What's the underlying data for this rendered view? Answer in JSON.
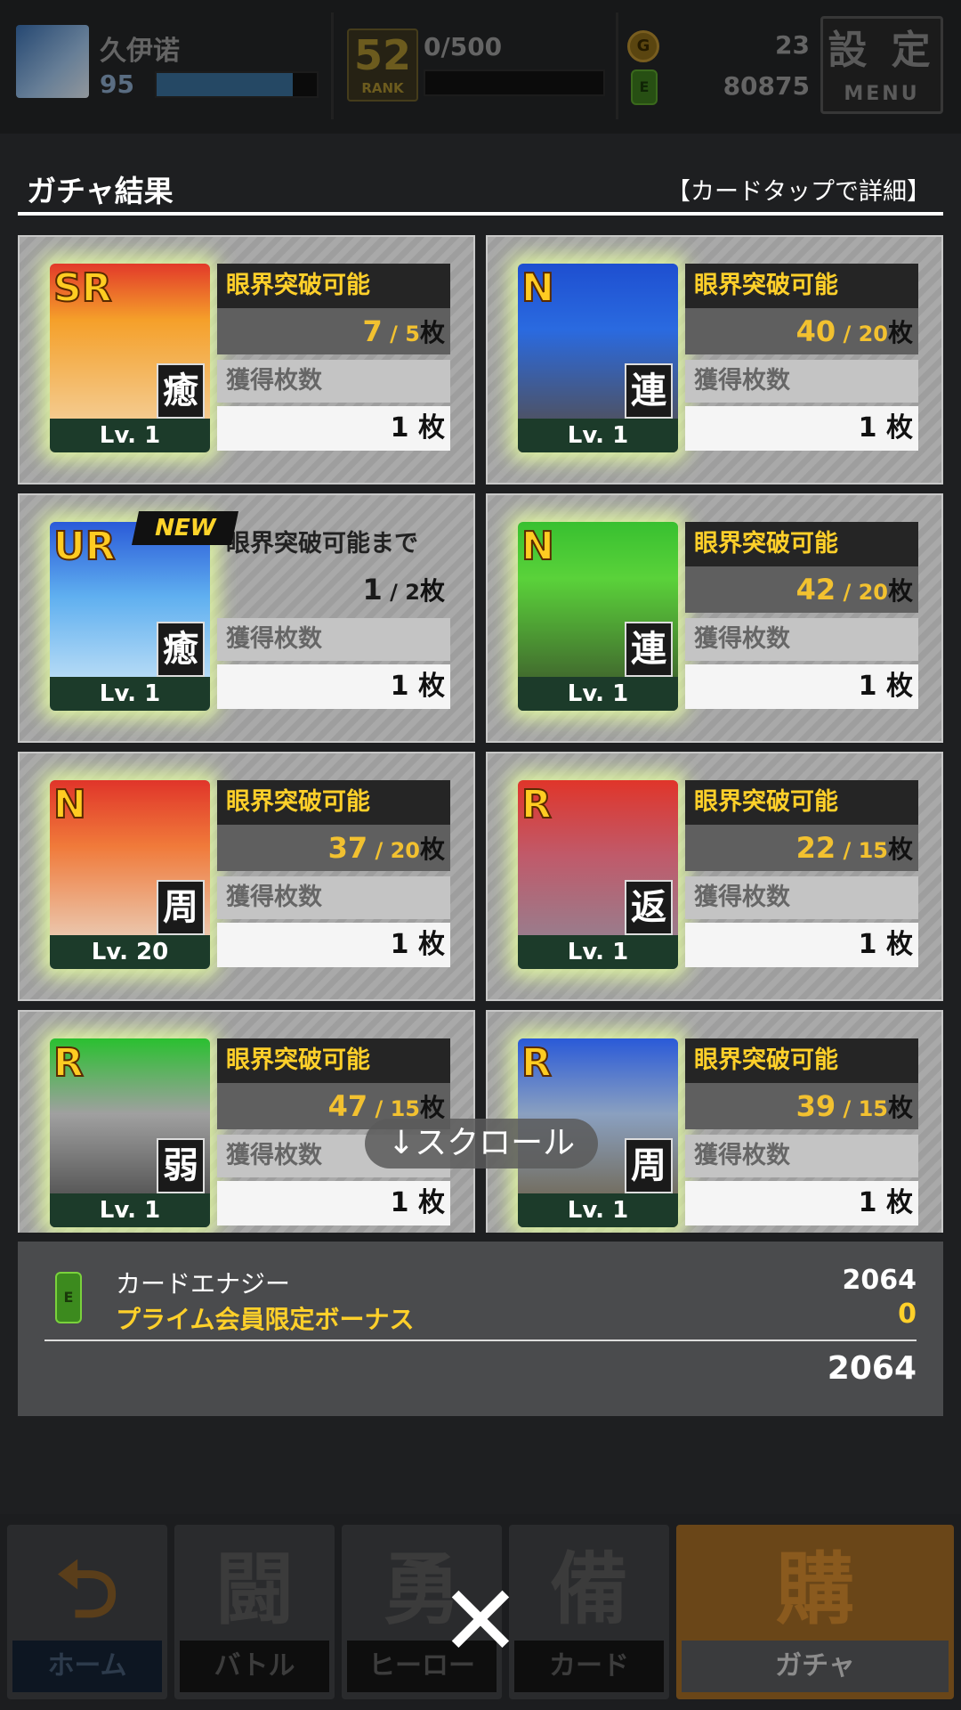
{
  "header": {
    "player_name": "久伊诺",
    "player_level": "95",
    "player_bar_fill": 0.85,
    "rank_number": "52",
    "rank_label": "RANK",
    "exp": "0/500",
    "exp_bar_fill": 0.0,
    "coins": "23",
    "energy_count": "80875",
    "menu_kanji": "設 定",
    "menu_label": "MENU"
  },
  "result": {
    "title": "ガチャ結果",
    "hint": "【カードタップで詳細】"
  },
  "labels": {
    "limit_break": "眼界突破可能",
    "limit_break_until": "眼界突破可能まで",
    "obtained": "獲得枚数",
    "unit": "枚"
  },
  "cards": [
    {
      "rarity": "SR",
      "attr": "癒",
      "level": "Lv. 1",
      "have": "7",
      "need": "5",
      "count": "1",
      "is_new": false,
      "status": "眼界突破可能",
      "art_color": "#c98a48"
    },
    {
      "rarity": "N",
      "attr": "連",
      "level": "Lv. 1",
      "have": "40",
      "need": "20",
      "count": "1",
      "is_new": false,
      "status": "眼界突破可能",
      "art_color": "#4a3a30"
    },
    {
      "rarity": "UR",
      "attr": "癒",
      "level": "Lv. 1",
      "have": "1",
      "need": "2",
      "count": "1",
      "is_new": true,
      "new_label": "NEW",
      "status": "眼界突破可能まで",
      "art_color": "#3a8ad8"
    },
    {
      "rarity": "N",
      "attr": "連",
      "level": "Lv. 1",
      "have": "42",
      "need": "20",
      "count": "1",
      "is_new": false,
      "status": "眼界突破可能",
      "art_color": "#4a6a3a"
    },
    {
      "rarity": "N",
      "attr": "周",
      "level": "Lv. 20",
      "have": "37",
      "need": "20",
      "count": "1",
      "is_new": false,
      "status": "眼界突破可能",
      "art_color": "#c83a2a"
    },
    {
      "rarity": "R",
      "attr": "返",
      "level": "Lv. 1",
      "have": "22",
      "need": "15",
      "count": "1",
      "is_new": false,
      "status": "眼界突破可能",
      "art_color": "#5a5a6a"
    },
    {
      "rarity": "R",
      "attr": "弱",
      "level": "Lv. 1",
      "have": "47",
      "need": "15",
      "count": "1",
      "is_new": false,
      "status": "眼界突破可能",
      "art_color": "#4a4a4a"
    },
    {
      "rarity": "R",
      "attr": "周",
      "level": "Lv. 1",
      "have": "39",
      "need": "15",
      "count": "1",
      "is_new": false,
      "status": "眼界突破可能",
      "art_color": "#3a5a8a"
    }
  ],
  "scroll_hint": "↓スクロール",
  "energy": {
    "label": "カードエナジー",
    "bonus_label": "プライム会員限定ボーナス",
    "value": "2064",
    "bonus_value": "0",
    "total": "2064"
  },
  "nav": [
    {
      "label": "ホーム",
      "icon_name": "home-return-icon",
      "glyph": "⮌"
    },
    {
      "label": "バトル",
      "icon_name": "battle-controller-icon",
      "glyph": "闘"
    },
    {
      "label": "ヒーロー",
      "icon_name": "hero-icon",
      "glyph": "勇"
    },
    {
      "label": "カード",
      "icon_name": "card-icon",
      "glyph": "備"
    },
    {
      "label": "ガチャ",
      "icon_name": "gacha-icon",
      "glyph": "購"
    }
  ],
  "close_glyph": "✕",
  "colors": {
    "accent_gold": "#ffd02a",
    "card_glow": "#e6ffa0",
    "gacha_tab": "#6a4618"
  }
}
